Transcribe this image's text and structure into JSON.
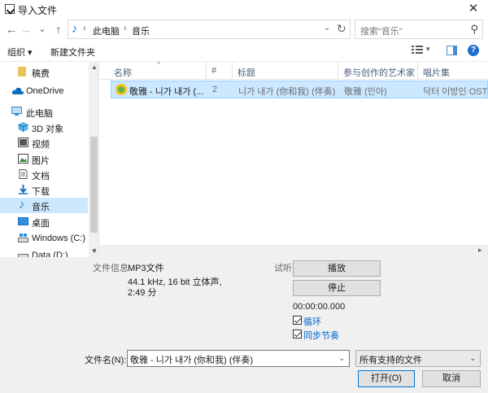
{
  "window": {
    "title": "导入文件",
    "close_glyph": "✕"
  },
  "nav": {
    "back": "←",
    "forward": "→",
    "recent": "⌄",
    "up": "↑",
    "breadcrumbs": [
      "此电脑",
      "音乐"
    ],
    "search_placeholder": "搜索\"音乐\""
  },
  "toolbar": {
    "organize": "组织 ▾",
    "new_folder": "新建文件夹",
    "help": "?"
  },
  "sidebar": {
    "items": [
      {
        "label": "稿费",
        "icon": "folder-icon"
      },
      {
        "label": "OneDrive",
        "icon": "cloud-icon"
      },
      {
        "label": "此电脑",
        "icon": "computer-icon"
      },
      {
        "label": "3D 对象",
        "icon": "3d-objects-icon"
      },
      {
        "label": "视频",
        "icon": "video-icon"
      },
      {
        "label": "图片",
        "icon": "pictures-icon"
      },
      {
        "label": "文档",
        "icon": "documents-icon"
      },
      {
        "label": "下载",
        "icon": "download-icon"
      },
      {
        "label": "音乐",
        "icon": "music-icon",
        "selected": true
      },
      {
        "label": "桌面",
        "icon": "desktop-icon"
      },
      {
        "label": "Windows (C:)",
        "icon": "drive-icon"
      },
      {
        "label": "Data (D:)",
        "icon": "drive-icon"
      }
    ]
  },
  "columns": [
    "名称",
    "#",
    "标题",
    "参与创作的艺术家",
    "唱片集"
  ],
  "files": [
    {
      "name": "敬雅 - 니가 내가 (...",
      "number": "2",
      "title": "니가 내가 (你和我) (伴奏)",
      "artist": "敬雅 (민아)",
      "album": "닥터 이방인 OST -"
    }
  ],
  "info": {
    "label": "文件信息",
    "format": "MP3文件",
    "details": "44.1 kHz, 16 bit 立体声,",
    "duration": "2:49 分"
  },
  "preview": {
    "label": "试听",
    "play": "播放",
    "stop": "停止",
    "time": "00:00:00.000",
    "loop": "循环",
    "sync": "同步节奏"
  },
  "filename": {
    "label": "文件名(N):",
    "value": "敬雅 - 니가 내가 (你和我) (伴奏)",
    "filter": "所有支持的文件"
  },
  "buttons": {
    "open": "打开(O)",
    "cancel": "取消"
  },
  "colors": {
    "selection": "#cce8ff",
    "accent": "#0078d7",
    "link": "#0066cc"
  }
}
